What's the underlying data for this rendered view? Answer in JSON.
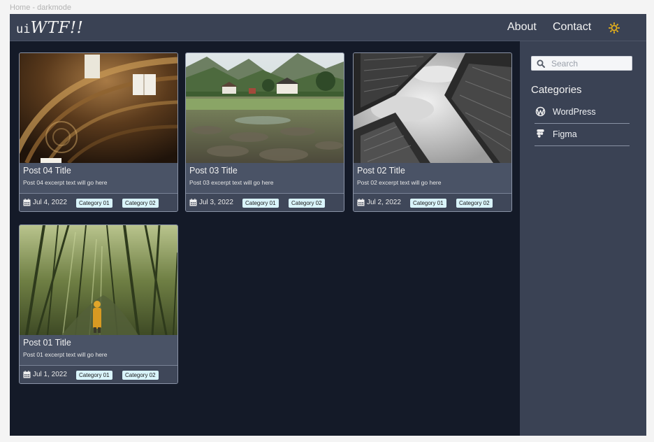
{
  "breadcrumb": "Home - darkmode",
  "header": {
    "logo_prefix": "ui",
    "logo_main": "WTF!!",
    "nav": {
      "about": "About",
      "contact": "Contact"
    },
    "theme_icon": "sun-icon"
  },
  "posts": [
    {
      "title": "Post 04 Title",
      "excerpt": "Post 04 excerpt text will go here",
      "date": "Jul 4, 2022",
      "categories": [
        "Category 01",
        "Category 02"
      ],
      "image": "cathedral-dome-photo"
    },
    {
      "title": "Post 03 Title",
      "excerpt": "Post 03 excerpt text will go here",
      "date": "Jul 3, 2022",
      "categories": [
        "Category 01",
        "Category 02"
      ],
      "image": "valley-houses-photo"
    },
    {
      "title": "Post 02 Title",
      "excerpt": "Post 02 excerpt text will go here",
      "date": "Jul 2, 2022",
      "categories": [
        "Category 01",
        "Category 02"
      ],
      "image": "skyscrapers-bw-photo"
    },
    {
      "title": "Post 01 Title",
      "excerpt": "Post 01 excerpt text will go here",
      "date": "Jul 1, 2022",
      "categories": [
        "Category 01",
        "Category 02"
      ],
      "image": "bamboo-forest-photo"
    }
  ],
  "sidebar": {
    "search_placeholder": "Search",
    "categories_heading": "Categories",
    "categories": [
      {
        "label": "WordPress",
        "icon": "wordpress-icon"
      },
      {
        "label": "Figma",
        "icon": "figma-icon"
      }
    ]
  },
  "colors": {
    "page_bg": "#141a28",
    "header_bg": "#3a4254",
    "card_bg": "#4a5366",
    "chip_bg": "#d9f4fb",
    "accent_sun": "#e8b21a"
  }
}
